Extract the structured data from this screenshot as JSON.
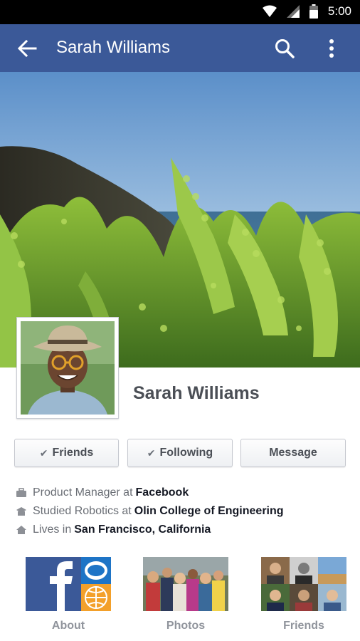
{
  "status_bar": {
    "time": "5:00",
    "icons": [
      "wifi-icon",
      "signal-icon",
      "battery-icon"
    ]
  },
  "app_bar": {
    "title": "Sarah Williams",
    "color": "#3b5998",
    "icons": [
      "back-arrow-icon",
      "search-icon",
      "more-vert-icon"
    ]
  },
  "profile": {
    "name": "Sarah Williams"
  },
  "actions": {
    "friends": "Friends",
    "following": "Following",
    "message": "Message"
  },
  "info": {
    "work": {
      "prefix": "Product Manager at",
      "value": "Facebook"
    },
    "education": {
      "prefix": "Studied Robotics at",
      "value": "Olin College of Engineering"
    },
    "home": {
      "prefix": "Lives in",
      "value": "San Francisco, California"
    }
  },
  "tiles": {
    "about": "About",
    "photos": "Photos",
    "friends": "Friends"
  }
}
